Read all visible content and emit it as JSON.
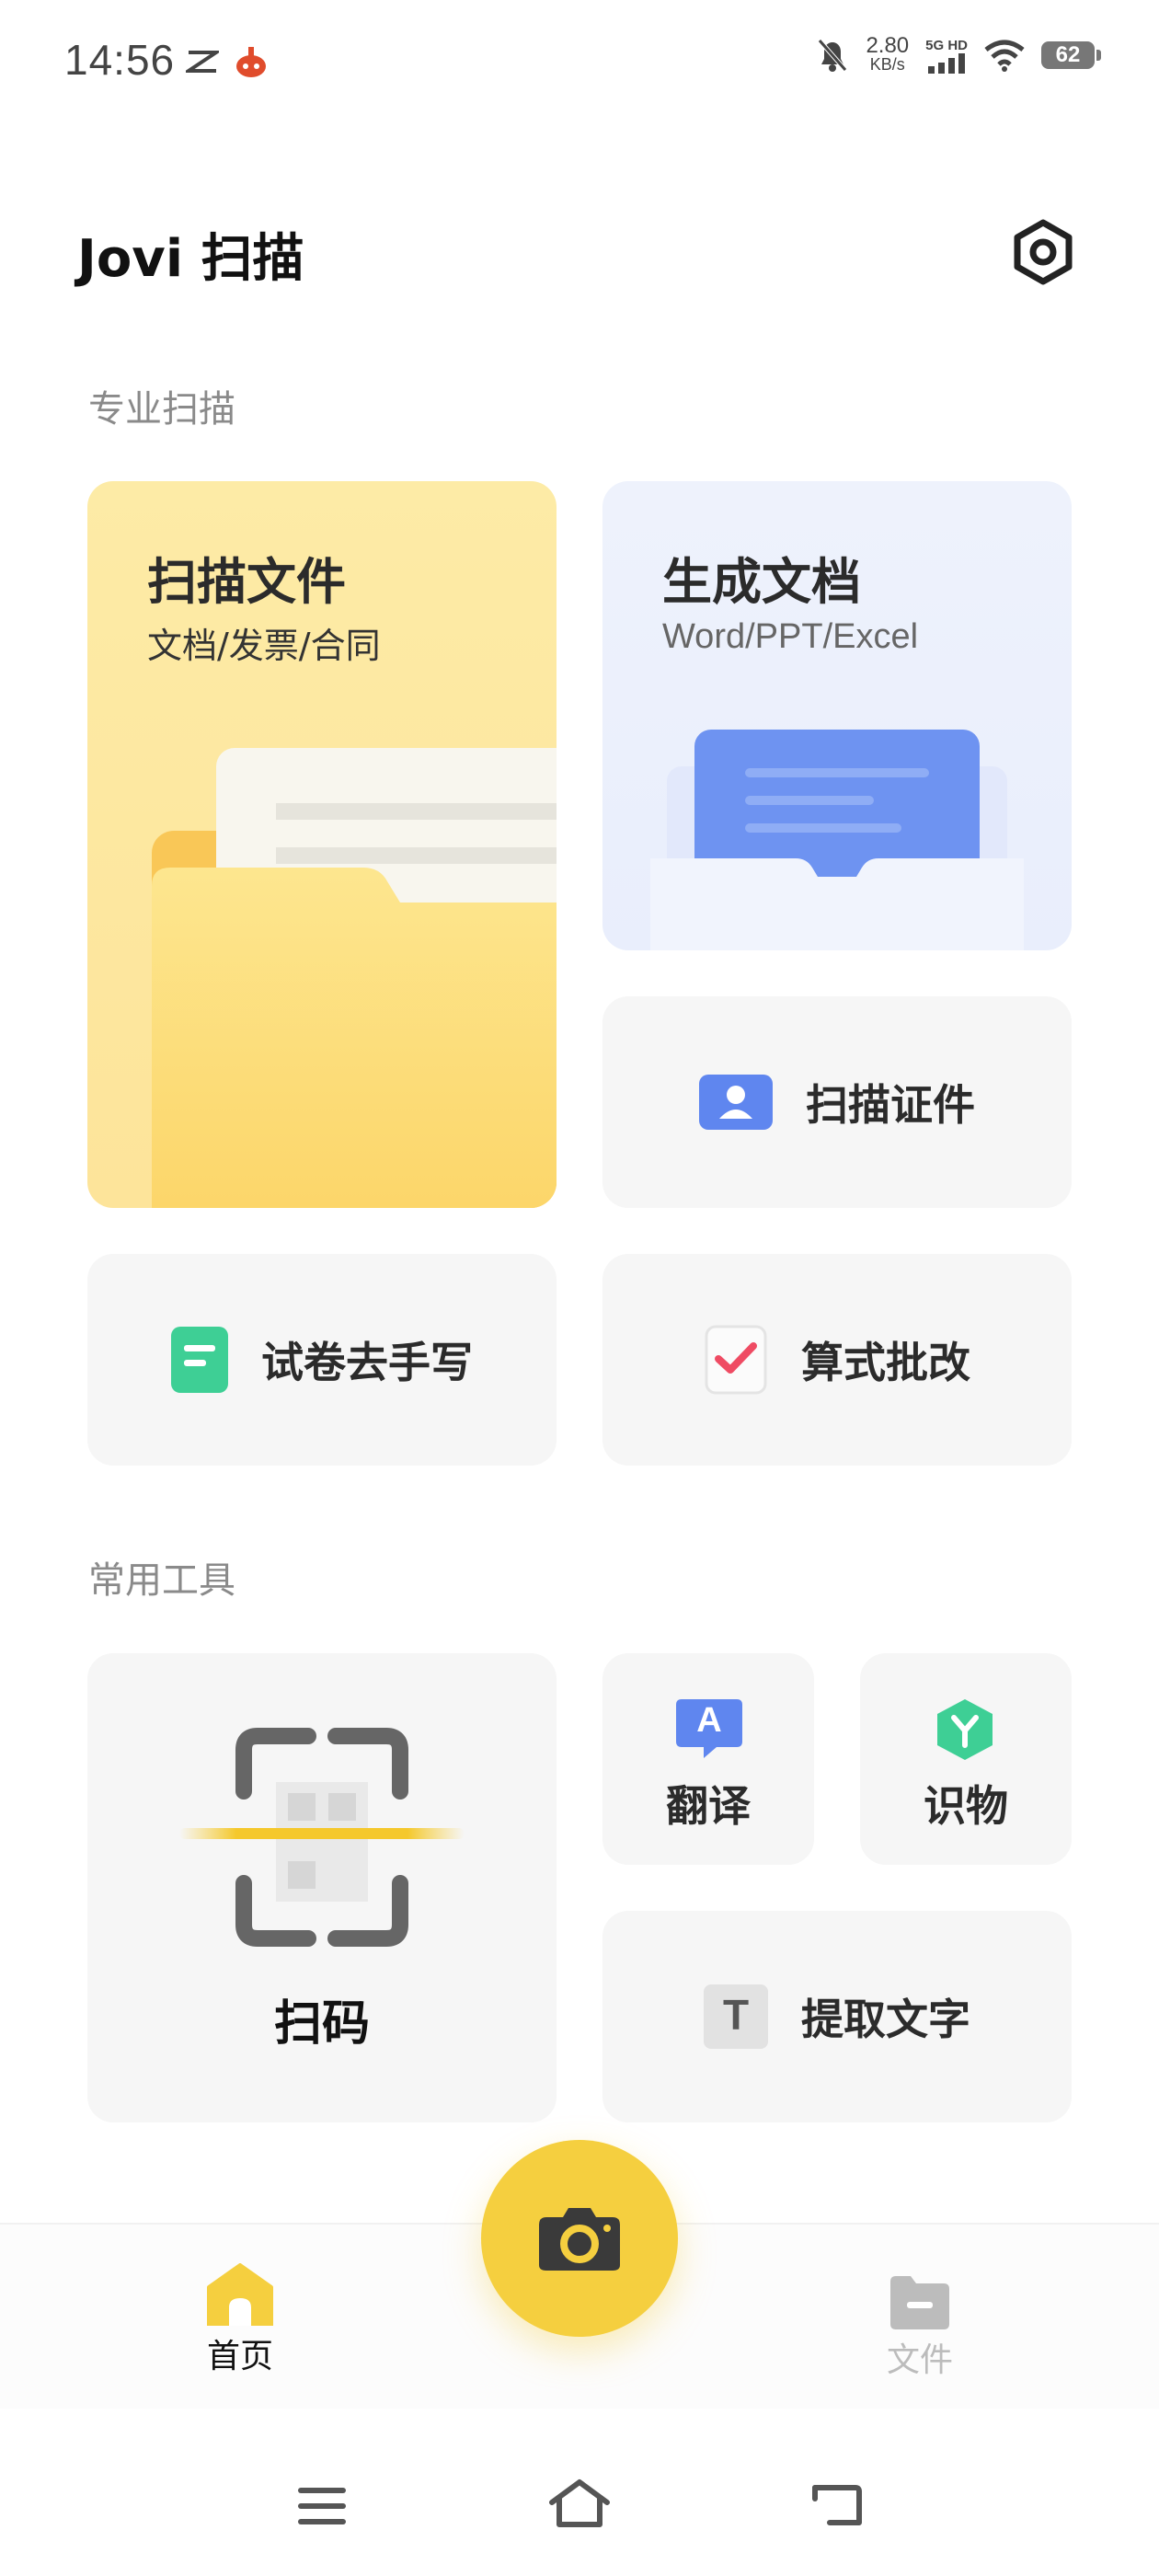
{
  "status_bar": {
    "time": "14:56",
    "speed_value": "2.80",
    "speed_unit": "KB/s",
    "network": "5G HD",
    "battery": "62"
  },
  "header": {
    "title": "Jovi 扫描"
  },
  "sections": {
    "pro_scan_label": "专业扫描",
    "common_tools_label": "常用工具"
  },
  "cards": {
    "scan_file": {
      "title": "扫描文件",
      "subtitle": "文档/发票/合同"
    },
    "gen_doc": {
      "title": "生成文档",
      "subtitle": "Word/PPT/Excel"
    },
    "scan_id": {
      "label": "扫描证件"
    },
    "remove_handwriting": {
      "label": "试卷去手写"
    },
    "math_check": {
      "label": "算式批改"
    },
    "scan_code": {
      "label": "扫码"
    },
    "translate": {
      "label": "翻译",
      "icon_letter": "A"
    },
    "identify": {
      "label": "识物"
    },
    "extract_text": {
      "label": "提取文字",
      "icon_letter": "T"
    }
  },
  "bottom_nav": {
    "home_label": "首页",
    "files_label": "文件"
  },
  "colors": {
    "accent_yellow": "#f5cf3f",
    "blue": "#6a8ef0",
    "green": "#3ecf95",
    "red_check": "#ef4b63"
  }
}
